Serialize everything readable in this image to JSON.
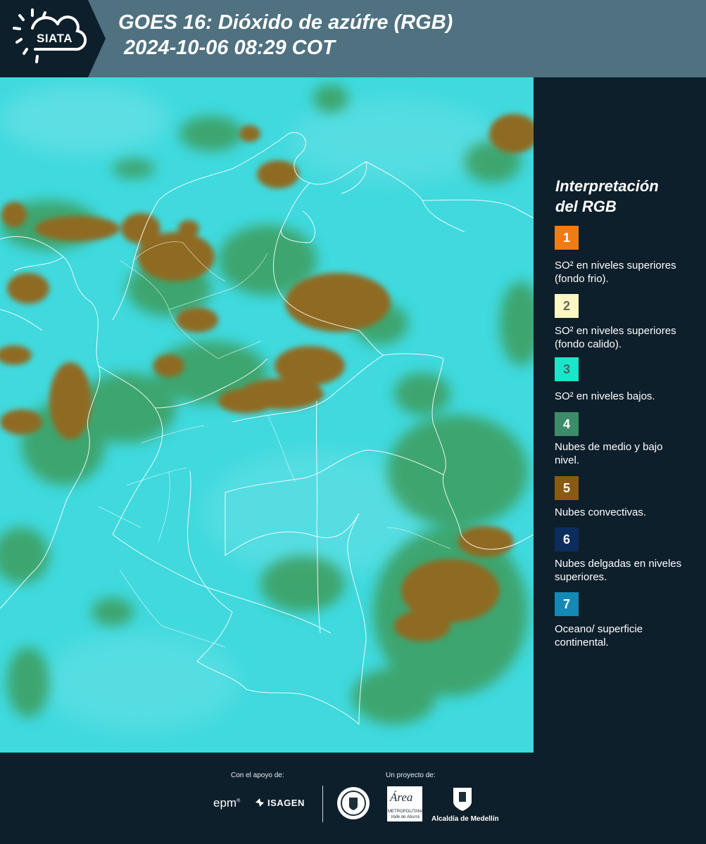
{
  "header": {
    "logo_text": "SIATA",
    "title_line1": "GOES 16: Dióxido de azúfre (RGB)",
    "title_line2": " 2024-10-06 08:29 COT"
  },
  "legend": {
    "title_line1": "Interpretación",
    "title_line2": "del RGB",
    "items": [
      {
        "number": "1",
        "color": "#f07d14",
        "text_color": "#ffffff",
        "label": "SO² en niveles superiores (fondo frio)."
      },
      {
        "number": "2",
        "color": "#fdf7c3",
        "text_color": "#6b6a58",
        "label": "SO² en niveles superiores (fondo calido)."
      },
      {
        "number": "3",
        "color": "#1be6c9",
        "text_color": "#3a6f6a",
        "label": "SO² en niveles bajos."
      },
      {
        "number": "4",
        "color": "#3d8c69",
        "text_color": "#ffffff",
        "label": "Nubes de medio y bajo nivel."
      },
      {
        "number": "5",
        "color": "#8a5a12",
        "text_color": "#ffffff",
        "label": "Nubes convectivas."
      },
      {
        "number": "6",
        "color": "#0c2c5c",
        "text_color": "#ffffff",
        "label": "Nubes delgadas en niveles superiores."
      },
      {
        "number": "7",
        "color": "#1589b5",
        "text_color": "#ffffff",
        "label": "Oceano/ superficie continental."
      }
    ]
  },
  "footer": {
    "support_label": "Con el apoyo de:",
    "project_label": "Un proyecto de:",
    "epm": "epm",
    "isagen": "ISAGEN",
    "area_label": "Área",
    "metro_label": "METROPOLITANA",
    "valle_label": "Valle de Aburrá",
    "alcaldia_label": "Alcaldía de Medellín"
  },
  "colors": {
    "header_bg": "#4f7180",
    "dark_bg": "#0d1f2b",
    "map_base": "#3fd9de",
    "cloud_convective": "#8a6a1e",
    "cloud_mid": "#3f9a5a"
  }
}
